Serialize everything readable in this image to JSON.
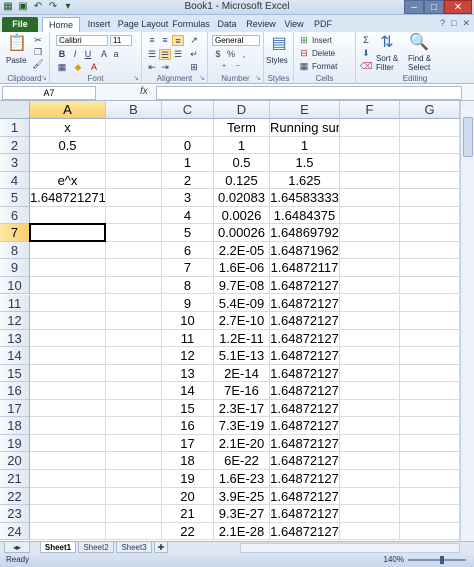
{
  "window": {
    "title": "Book1 - Microsoft Excel",
    "minimize": "–",
    "maximize": "□",
    "close": "✕"
  },
  "ribbon": {
    "tabs": [
      "File",
      "Home",
      "Insert",
      "Page Layout",
      "Formulas",
      "Data",
      "Review",
      "View",
      "PDF"
    ],
    "active_tab": "Home",
    "clipboard": {
      "paste": "Paste",
      "label": "Clipboard"
    },
    "font": {
      "name": "Calibri",
      "size": "11",
      "label": "Font"
    },
    "alignment": {
      "label": "Alignment"
    },
    "number": {
      "format": "General",
      "label": "Number"
    },
    "styles": {
      "label": "Styles"
    },
    "cells": {
      "insert": "Insert",
      "delete": "Delete",
      "format": "Format",
      "label": "Cells"
    },
    "editing": {
      "sort": "Sort &",
      "filter": "Filter",
      "find": "Find &",
      "select": "Select",
      "label": "Editing"
    }
  },
  "formula_bar": {
    "name_box": "A7",
    "fx": "fx",
    "content": ""
  },
  "columns": [
    "A",
    "B",
    "C",
    "D",
    "E",
    "F",
    "G"
  ],
  "selected": {
    "col": "A",
    "row": 7
  },
  "rows": [
    {
      "n": "1",
      "a": "x",
      "c": "",
      "d": "Term",
      "e": "Running sum"
    },
    {
      "n": "2",
      "a": "0.5",
      "c": "0",
      "d": "1",
      "e": "1"
    },
    {
      "n": "3",
      "a": "",
      "c": "1",
      "d": "0.5",
      "e": "1.5"
    },
    {
      "n": "4",
      "a": "e^x",
      "c": "2",
      "d": "0.125",
      "e": "1.625"
    },
    {
      "n": "5",
      "a": "1.648721271",
      "c": "3",
      "d": "0.02083",
      "e": "1.64583333"
    },
    {
      "n": "6",
      "a": "",
      "c": "4",
      "d": "0.0026",
      "e": "1.6484375"
    },
    {
      "n": "7",
      "a": "",
      "c": "5",
      "d": "0.00026",
      "e": "1.64869792"
    },
    {
      "n": "8",
      "a": "",
      "c": "6",
      "d": "2.2E-05",
      "e": "1.64871962"
    },
    {
      "n": "9",
      "a": "",
      "c": "7",
      "d": "1.6E-06",
      "e": "1.64872117"
    },
    {
      "n": "10",
      "a": "",
      "c": "8",
      "d": "9.7E-08",
      "e": "1.64872127"
    },
    {
      "n": "11",
      "a": "",
      "c": "9",
      "d": "5.4E-09",
      "e": "1.64872127"
    },
    {
      "n": "12",
      "a": "",
      "c": "10",
      "d": "2.7E-10",
      "e": "1.64872127"
    },
    {
      "n": "13",
      "a": "",
      "c": "11",
      "d": "1.2E-11",
      "e": "1.64872127"
    },
    {
      "n": "14",
      "a": "",
      "c": "12",
      "d": "5.1E-13",
      "e": "1.64872127"
    },
    {
      "n": "15",
      "a": "",
      "c": "13",
      "d": "2E-14",
      "e": "1.64872127"
    },
    {
      "n": "16",
      "a": "",
      "c": "14",
      "d": "7E-16",
      "e": "1.64872127"
    },
    {
      "n": "17",
      "a": "",
      "c": "15",
      "d": "2.3E-17",
      "e": "1.64872127"
    },
    {
      "n": "18",
      "a": "",
      "c": "16",
      "d": "7.3E-19",
      "e": "1.64872127"
    },
    {
      "n": "19",
      "a": "",
      "c": "17",
      "d": "2.1E-20",
      "e": "1.64872127"
    },
    {
      "n": "20",
      "a": "",
      "c": "18",
      "d": "6E-22",
      "e": "1.64872127"
    },
    {
      "n": "21",
      "a": "",
      "c": "19",
      "d": "1.6E-23",
      "e": "1.64872127"
    },
    {
      "n": "22",
      "a": "",
      "c": "20",
      "d": "3.9E-25",
      "e": "1.64872127"
    },
    {
      "n": "23",
      "a": "",
      "c": "21",
      "d": "9.3E-27",
      "e": "1.64872127"
    },
    {
      "n": "24",
      "a": "",
      "c": "22",
      "d": "2.1E-28",
      "e": "1.64872127"
    }
  ],
  "sheets": [
    "Sheet1",
    "Sheet2",
    "Sheet3"
  ],
  "active_sheet": "Sheet1",
  "status": {
    "text": "Ready",
    "zoom": "140%"
  }
}
